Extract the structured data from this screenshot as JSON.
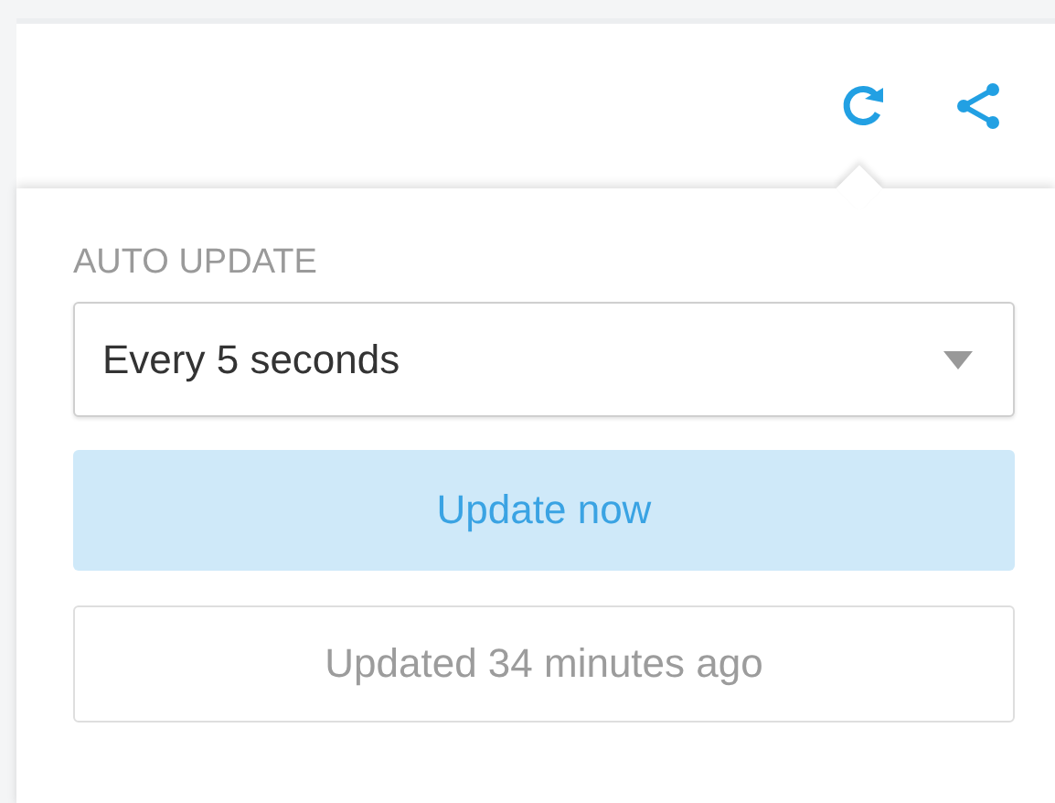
{
  "toolbar": {
    "icons": [
      {
        "kind": "refresh"
      },
      {
        "kind": "share"
      }
    ]
  },
  "popover": {
    "label": "AUTO UPDATE",
    "interval_select": {
      "value": "Every 5 seconds"
    },
    "update_button": "Update now",
    "status": "Updated 34 minutes ago"
  }
}
